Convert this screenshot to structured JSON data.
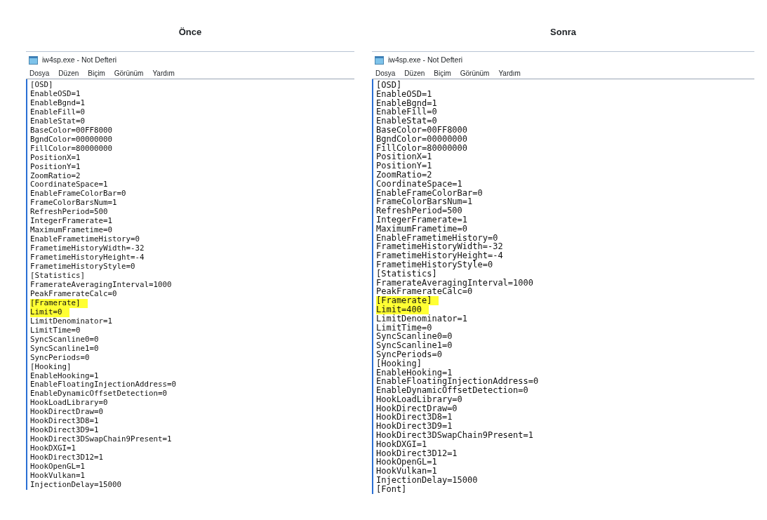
{
  "panels": [
    {
      "heading": "Önce",
      "window": {
        "title": "iw4sp.exe - Not Defteri",
        "menu": [
          "Dosya",
          "Düzen",
          "Biçim",
          "Görünüm",
          "Yardım"
        ]
      },
      "lines": [
        {
          "text": "[OSD]",
          "highlighted": false
        },
        {
          "text": "EnableOSD=1",
          "highlighted": false
        },
        {
          "text": "EnableBgnd=1",
          "highlighted": false
        },
        {
          "text": "EnableFill=0",
          "highlighted": false
        },
        {
          "text": "EnableStat=0",
          "highlighted": false
        },
        {
          "text": "BaseColor=00FF8000",
          "highlighted": false
        },
        {
          "text": "BgndColor=00000000",
          "highlighted": false
        },
        {
          "text": "FillColor=80000000",
          "highlighted": false
        },
        {
          "text": "PositionX=1",
          "highlighted": false
        },
        {
          "text": "PositionY=1",
          "highlighted": false
        },
        {
          "text": "ZoomRatio=2",
          "highlighted": false
        },
        {
          "text": "CoordinateSpace=1",
          "highlighted": false
        },
        {
          "text": "EnableFrameColorBar=0",
          "highlighted": false
        },
        {
          "text": "FrameColorBarsNum=1",
          "highlighted": false
        },
        {
          "text": "RefreshPeriod=500",
          "highlighted": false
        },
        {
          "text": "IntegerFramerate=1",
          "highlighted": false
        },
        {
          "text": "MaximumFrametime=0",
          "highlighted": false
        },
        {
          "text": "EnableFrametimeHistory=0",
          "highlighted": false
        },
        {
          "text": "FrametimeHistoryWidth=-32",
          "highlighted": false
        },
        {
          "text": "FrametimeHistoryHeight=-4",
          "highlighted": false
        },
        {
          "text": "FrametimeHistoryStyle=0",
          "highlighted": false
        },
        {
          "text": "[Statistics]",
          "highlighted": false
        },
        {
          "text": "FramerateAveragingInterval=1000",
          "highlighted": false
        },
        {
          "text": "PeakFramerateCalc=0",
          "highlighted": false
        },
        {
          "text": "[Framerate]",
          "highlighted": true
        },
        {
          "text": "Limit=0",
          "highlighted": true
        },
        {
          "text": "LimitDenominator=1",
          "highlighted": false
        },
        {
          "text": "LimitTime=0",
          "highlighted": false
        },
        {
          "text": "SyncScanline0=0",
          "highlighted": false
        },
        {
          "text": "SyncScanline1=0",
          "highlighted": false
        },
        {
          "text": "SyncPeriods=0",
          "highlighted": false
        },
        {
          "text": "[Hooking]",
          "highlighted": false
        },
        {
          "text": "EnableHooking=1",
          "highlighted": false
        },
        {
          "text": "EnableFloatingInjectionAddress=0",
          "highlighted": false
        },
        {
          "text": "EnableDynamicOffsetDetection=0",
          "highlighted": false
        },
        {
          "text": "HookLoadLibrary=0",
          "highlighted": false
        },
        {
          "text": "HookDirectDraw=0",
          "highlighted": false
        },
        {
          "text": "HookDirect3D8=1",
          "highlighted": false
        },
        {
          "text": "HookDirect3D9=1",
          "highlighted": false
        },
        {
          "text": "HookDirect3DSwapChain9Present=1",
          "highlighted": false
        },
        {
          "text": "HookDXGI=1",
          "highlighted": false
        },
        {
          "text": "HookDirect3D12=1",
          "highlighted": false
        },
        {
          "text": "HookOpenGL=1",
          "highlighted": false
        },
        {
          "text": "HookVulkan=1",
          "highlighted": false
        },
        {
          "text": "InjectionDelay=15000",
          "highlighted": false
        }
      ]
    },
    {
      "heading": "Sonra",
      "window": {
        "title": "iw4sp.exe - Not Defteri",
        "menu": [
          "Dosya",
          "Düzen",
          "Biçim",
          "Görünüm",
          "Yardım"
        ]
      },
      "lines": [
        {
          "text": "[OSD]",
          "highlighted": false
        },
        {
          "text": "EnableOSD=1",
          "highlighted": false
        },
        {
          "text": "EnableBgnd=1",
          "highlighted": false
        },
        {
          "text": "EnableFill=0",
          "highlighted": false
        },
        {
          "text": "EnableStat=0",
          "highlighted": false
        },
        {
          "text": "BaseColor=00FF8000",
          "highlighted": false
        },
        {
          "text": "BgndColor=00000000",
          "highlighted": false
        },
        {
          "text": "FillColor=80000000",
          "highlighted": false
        },
        {
          "text": "PositionX=1",
          "highlighted": false
        },
        {
          "text": "PositionY=1",
          "highlighted": false
        },
        {
          "text": "ZoomRatio=2",
          "highlighted": false
        },
        {
          "text": "CoordinateSpace=1",
          "highlighted": false
        },
        {
          "text": "EnableFrameColorBar=0",
          "highlighted": false
        },
        {
          "text": "FrameColorBarsNum=1",
          "highlighted": false
        },
        {
          "text": "RefreshPeriod=500",
          "highlighted": false
        },
        {
          "text": "IntegerFramerate=1",
          "highlighted": false
        },
        {
          "text": "MaximumFrametime=0",
          "highlighted": false
        },
        {
          "text": "EnableFrametimeHistory=0",
          "highlighted": false
        },
        {
          "text": "FrametimeHistoryWidth=-32",
          "highlighted": false
        },
        {
          "text": "FrametimeHistoryHeight=-4",
          "highlighted": false
        },
        {
          "text": "FrametimeHistoryStyle=0",
          "highlighted": false
        },
        {
          "text": "[Statistics]",
          "highlighted": false
        },
        {
          "text": "FramerateAveragingInterval=1000",
          "highlighted": false
        },
        {
          "text": "PeakFramerateCalc=0",
          "highlighted": false
        },
        {
          "text": "[Framerate]",
          "highlighted": true
        },
        {
          "text": "Limit=400",
          "highlighted": true
        },
        {
          "text": "LimitDenominator=1",
          "highlighted": false
        },
        {
          "text": "LimitTime=0",
          "highlighted": false
        },
        {
          "text": "SyncScanline0=0",
          "highlighted": false
        },
        {
          "text": "SyncScanline1=0",
          "highlighted": false
        },
        {
          "text": "SyncPeriods=0",
          "highlighted": false
        },
        {
          "text": "[Hooking]",
          "highlighted": false
        },
        {
          "text": "EnableHooking=1",
          "highlighted": false
        },
        {
          "text": "EnableFloatingInjectionAddress=0",
          "highlighted": false
        },
        {
          "text": "EnableDynamicOffsetDetection=0",
          "highlighted": false
        },
        {
          "text": "HookLoadLibrary=0",
          "highlighted": false
        },
        {
          "text": "HookDirectDraw=0",
          "highlighted": false
        },
        {
          "text": "HookDirect3D8=1",
          "highlighted": false
        },
        {
          "text": "HookDirect3D9=1",
          "highlighted": false
        },
        {
          "text": "HookDirect3DSwapChain9Present=1",
          "highlighted": false
        },
        {
          "text": "HookDXGI=1",
          "highlighted": false
        },
        {
          "text": "HookDirect3D12=1",
          "highlighted": false
        },
        {
          "text": "HookOpenGL=1",
          "highlighted": false
        },
        {
          "text": "HookVulkan=1",
          "highlighted": false
        },
        {
          "text": "InjectionDelay=15000",
          "highlighted": false
        },
        {
          "text": "[Font]",
          "highlighted": false
        }
      ]
    }
  ]
}
